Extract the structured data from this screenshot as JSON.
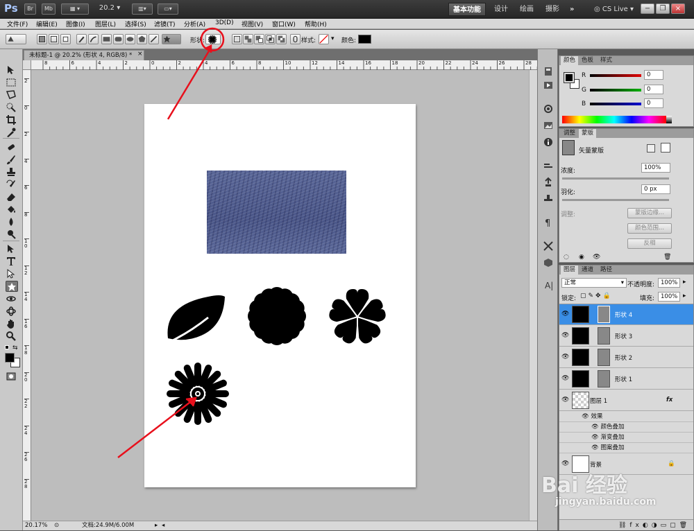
{
  "app": {
    "logo": "Ps",
    "mini_buttons": [
      "Br",
      "Mb"
    ],
    "zoom_select": "20.2",
    "workspaces": [
      "基本功能",
      "设计",
      "绘画",
      "摄影"
    ],
    "active_workspace": "基本功能",
    "more": "»",
    "cslive": "CS Live"
  },
  "menu": [
    "文件(F)",
    "编辑(E)",
    "图像(I)",
    "图层(L)",
    "选择(S)",
    "滤镜(T)",
    "分析(A)",
    "3D(D)",
    "视图(V)",
    "窗口(W)",
    "帮助(H)"
  ],
  "options": {
    "shape_label": "形状:",
    "style_label": "样式:",
    "color_label": "颜色:",
    "color": "#000000"
  },
  "document": {
    "tab_title": "未标题-1 @ 20.2% (形状 4, RGB/8) *",
    "close": "×",
    "ruler_h": [
      "8",
      "6",
      "4",
      "2",
      "0",
      "2",
      "4",
      "6",
      "8",
      "10",
      "12",
      "14",
      "16",
      "18",
      "20",
      "22",
      "24",
      "26",
      "28"
    ],
    "ruler_v": [
      "2",
      "0",
      "2",
      "4",
      "6",
      "8",
      "1 0",
      "1 2",
      "1 4",
      "1 6",
      "1 8",
      "2 0",
      "2 2",
      "2 4",
      "2 6",
      "2 8"
    ]
  },
  "status": {
    "zoom": "20.17%",
    "doc_size": "文档:24.9M/6.00M"
  },
  "color_panel": {
    "tabs": [
      "颜色",
      "色板",
      "样式"
    ],
    "channels": [
      {
        "label": "R",
        "value": "0",
        "color": "#e00000"
      },
      {
        "label": "G",
        "value": "0",
        "color": "#00b000"
      },
      {
        "label": "B",
        "value": "0",
        "color": "#0000d0"
      }
    ],
    "fg": "#000000",
    "bg": "#ffffff"
  },
  "adjust_panel": {
    "tabs": [
      "调整",
      "蒙版"
    ],
    "title": "矢量蒙版",
    "density_label": "浓度:",
    "density_value": "100%",
    "feather_label": "羽化:",
    "feather_value": "0 px",
    "refine_label": "调整:",
    "buttons": [
      "蒙版边缘...",
      "颜色范围...",
      "反相"
    ]
  },
  "layers_panel": {
    "tabs": [
      "图层",
      "通道",
      "路径"
    ],
    "blend_mode": "正常",
    "opacity_label": "不透明度:",
    "opacity_value": "100%",
    "lock_label": "锁定:",
    "fill_label": "填充:",
    "fill_value": "100%",
    "layers": [
      {
        "name": "形状 4",
        "selected": true
      },
      {
        "name": "形状 3",
        "selected": false
      },
      {
        "name": "形状 2",
        "selected": false
      },
      {
        "name": "形状 1",
        "selected": false
      }
    ],
    "image_layer": "图层 1",
    "fx": "fx",
    "effects_label": "效果",
    "effects": [
      "颜色叠加",
      "渐变叠加",
      "图案叠加"
    ],
    "background_layer": "背景"
  },
  "watermark": {
    "brand": "Bai 经验",
    "url": "jingyan.baidu.com"
  },
  "accent": "#e8101c"
}
